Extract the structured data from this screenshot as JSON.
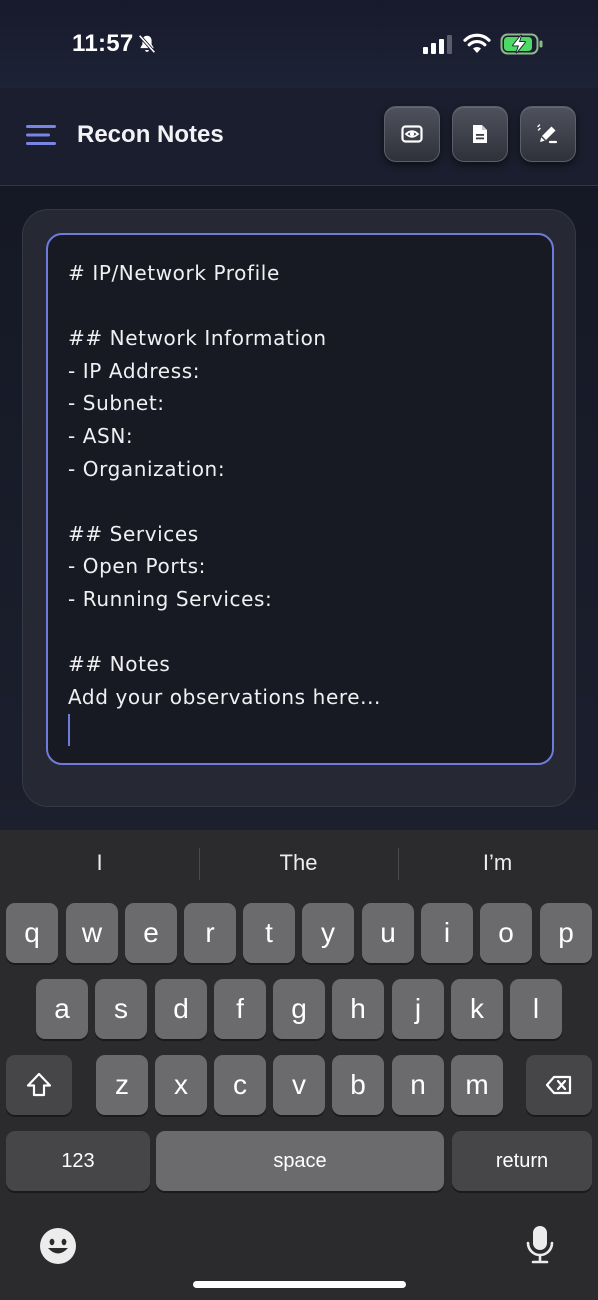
{
  "status_bar": {
    "time": "11:57",
    "icons": [
      "bell-slash-icon",
      "cellular-signal-icon",
      "wifi-icon",
      "battery-charging-icon"
    ]
  },
  "header": {
    "title": "Recon Notes",
    "buttons": [
      "eye-icon",
      "document-icon",
      "edit-pencil-icon"
    ],
    "accent_color": "#6e7bd8"
  },
  "editor": {
    "content": "# IP/Network Profile\n\n## Network Information\n- IP Address:\n- Subnet:\n- ASN:\n- Organization:\n\n## Services\n- Open Ports:\n- Running Services:\n\n## Notes\nAdd your observations here...\n"
  },
  "keyboard": {
    "suggestions": [
      "I",
      "The",
      "I’m"
    ],
    "row1": [
      "q",
      "w",
      "e",
      "r",
      "t",
      "y",
      "u",
      "i",
      "o",
      "p"
    ],
    "row2": [
      "a",
      "s",
      "d",
      "f",
      "g",
      "h",
      "j",
      "k",
      "l"
    ],
    "row3": [
      "z",
      "x",
      "c",
      "v",
      "b",
      "n",
      "m"
    ],
    "numbers_label": "123",
    "space_label": "space",
    "return_label": "return",
    "icons": [
      "shift-icon",
      "backspace-icon",
      "emoji-icon",
      "microphone-icon"
    ]
  }
}
